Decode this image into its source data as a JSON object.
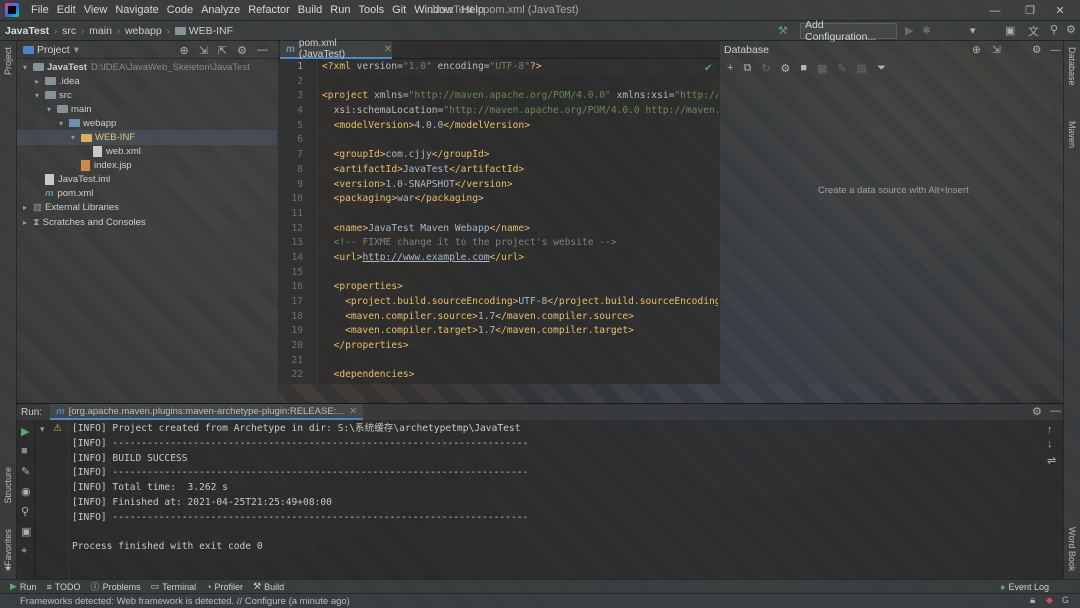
{
  "menu": {
    "items": [
      "File",
      "Edit",
      "View",
      "Navigate",
      "Code",
      "Analyze",
      "Refactor",
      "Build",
      "Run",
      "Tools",
      "Git",
      "Window",
      "Help"
    ],
    "title": "JavaTest - pom.xml (JavaTest)"
  },
  "breadcrumb": [
    "JavaTest",
    "src",
    "main",
    "webapp",
    "WEB-INF"
  ],
  "toolbar": {
    "add_configuration": "Add Configuration..."
  },
  "project": {
    "header": "Project",
    "tree": [
      {
        "label": "JavaTest",
        "extra": "D:\\IDEA\\JavaWeb_Skeleton\\JavaTest",
        "depth": 0,
        "arrow": "▾",
        "kind": "folder",
        "bold": true
      },
      {
        "label": ".idea",
        "depth": 1,
        "arrow": "▸",
        "kind": "folder"
      },
      {
        "label": "src",
        "depth": 1,
        "arrow": "▾",
        "kind": "folder"
      },
      {
        "label": "main",
        "depth": 2,
        "arrow": "▾",
        "kind": "folder"
      },
      {
        "label": "webapp",
        "depth": 3,
        "arrow": "▾",
        "kind": "folder-blue"
      },
      {
        "label": "WEB-INF",
        "depth": 4,
        "arrow": "▾",
        "kind": "folder-y",
        "selected": true
      },
      {
        "label": "web.xml",
        "depth": 5,
        "arrow": "",
        "kind": "file"
      },
      {
        "label": "index.jsp",
        "depth": 4,
        "arrow": "",
        "kind": "file-jsp"
      },
      {
        "label": "JavaTest.iml",
        "depth": 1,
        "arrow": "",
        "kind": "file"
      },
      {
        "label": "pom.xml",
        "depth": 1,
        "arrow": "",
        "kind": "maven"
      },
      {
        "label": "External Libraries",
        "depth": 0,
        "arrow": "▸",
        "kind": "lib"
      },
      {
        "label": "Scratches and Consoles",
        "depth": 0,
        "arrow": "▸",
        "kind": "scratch"
      }
    ]
  },
  "editor": {
    "tab": "pom.xml (JavaTest)",
    "line_numbers": [
      "1",
      "2",
      "3",
      "4",
      "5",
      "6",
      "7",
      "8",
      "9",
      "10",
      "11",
      "12",
      "13",
      "14",
      "15",
      "16",
      "17",
      "18",
      "19",
      "20",
      "21",
      "22"
    ]
  },
  "database": {
    "header": "Database",
    "hint": "Create a data source with Alt+Insert"
  },
  "run": {
    "label": "Run:",
    "tab": "[org.apache.maven.plugins:maven-archetype-plugin:RELEASE:...",
    "lines": [
      "[INFO] Project created from Archetype in dir: S:\\系统缓存\\archetypetmp\\JavaTest",
      "[INFO] ------------------------------------------------------------------------",
      "[INFO] BUILD SUCCESS",
      "[INFO] ------------------------------------------------------------------------",
      "[INFO] Total time:  3.262 s",
      "[INFO] Finished at: 2021-04-25T21:25:49+08:00",
      "[INFO] ------------------------------------------------------------------------",
      "",
      "Process finished with exit code 0"
    ]
  },
  "bottom_tabs": [
    "Run",
    "TODO",
    "Problems",
    "Terminal",
    "Profiler",
    "Build"
  ],
  "event_log": "Event Log",
  "status": "Frameworks detected: Web framework is detected. // Configure (a minute ago)",
  "stripes": {
    "project": "Project",
    "structure": "Structure",
    "favorites": "Favorites",
    "database": "Database",
    "maven": "Maven",
    "wordbook": "Word Book"
  }
}
